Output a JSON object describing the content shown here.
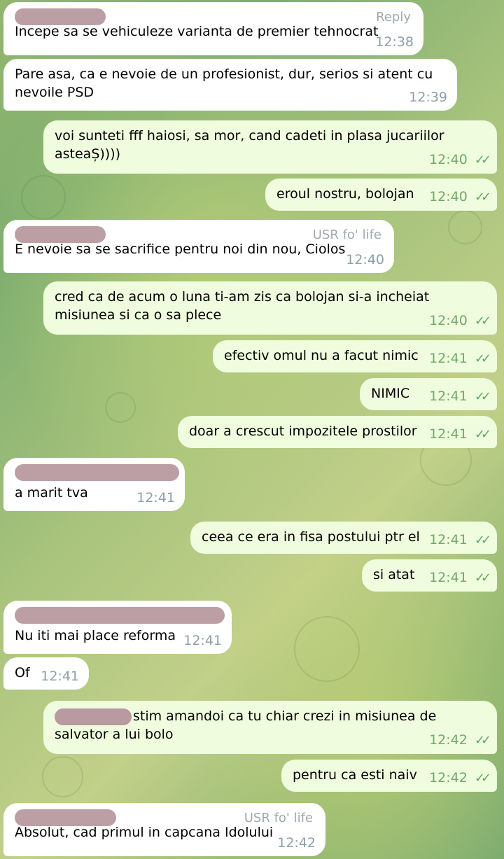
{
  "messages": [
    {
      "dir": "in",
      "sender_redacted": true,
      "tag": "Reply",
      "text": "Incepe sa se vehiculeze varianta de premier tehnocrat",
      "time": "12:38"
    },
    {
      "dir": "in",
      "sender_redacted": false,
      "tag": "",
      "text": "Pare asa, ca e nevoie de un profesionist, dur, serios si atent cu nevoile PSD",
      "time": "12:39"
    },
    {
      "dir": "out",
      "text": "voi sunteti fff haiosi, sa mor, cand cadeti in plasa jucariilor asteaȘ))))",
      "time": "12:40",
      "read": true
    },
    {
      "dir": "out",
      "text": "eroul nostru, bolojan",
      "time": "12:40",
      "read": true
    },
    {
      "dir": "in",
      "sender_redacted": true,
      "tag": "USR fo' life",
      "text": "E nevoie sa se sacrifice pentru noi din nou, Ciolos",
      "time": "12:40"
    },
    {
      "dir": "out",
      "text": "cred ca de acum o luna ti-am zis ca bolojan si-a incheiat misiunea si ca o sa plece",
      "time": "12:40",
      "read": true
    },
    {
      "dir": "out",
      "text": "efectiv omul nu a facut nimic",
      "time": "12:41",
      "read": true
    },
    {
      "dir": "out",
      "text": "NIMIC",
      "time": "12:41",
      "read": true
    },
    {
      "dir": "out",
      "text": "doar a crescut impozitele prostilor",
      "time": "12:41",
      "read": true
    },
    {
      "dir": "in",
      "sender_redacted": true,
      "tag": "",
      "text": "a marit tva",
      "time": "12:41"
    },
    {
      "dir": "out",
      "text": "ceea ce era in fisa postului ptr el",
      "time": "12:41",
      "read": true
    },
    {
      "dir": "out",
      "text": "si atat",
      "time": "12:41",
      "read": true
    },
    {
      "dir": "in",
      "sender_redacted": true,
      "tag": "",
      "text": "Nu iti mai place reforma",
      "time": "12:41"
    },
    {
      "dir": "in",
      "sender_redacted": false,
      "tag": "",
      "text": "Of",
      "time": "12:41"
    },
    {
      "dir": "out",
      "text": "stim amandoi ca tu chiar crezi in misiunea de salvator a lui bolo",
      "time": "12:42",
      "read": true,
      "mention_redacted": true
    },
    {
      "dir": "out",
      "text": "pentru ca esti naiv",
      "time": "12:42",
      "read": true
    },
    {
      "dir": "in",
      "sender_redacted": true,
      "tag": "USR fo' life",
      "text": "Absolut, cad primul in capcana Idolului",
      "time": "12:42"
    }
  ],
  "icons": {
    "read_receipt": "double-check-icon"
  }
}
